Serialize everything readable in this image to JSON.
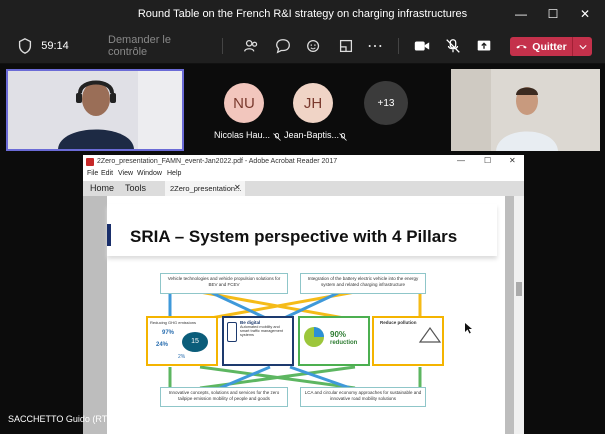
{
  "window": {
    "title": "Round Table on the French R&I strategy on charging infrastructures"
  },
  "toolbar": {
    "timer": "59:14",
    "request_control": "Demander le contrôle",
    "leave_label": "Quitter"
  },
  "participants": [
    {
      "initials": "NU",
      "name": "Nicolas Hau...",
      "color": "#f2c6bd"
    },
    {
      "initials": "JH",
      "name": "Jean-Baptis...",
      "color": "#f0d4c6"
    }
  ],
  "more_count": "+13",
  "acrobat": {
    "title": "2Zero_presentation_FAMN_event-Jan2022.pdf - Adobe Acrobat Reader 2017",
    "menu": [
      "File",
      "Edit",
      "View",
      "Window",
      "Help"
    ],
    "tabs": [
      "Home",
      "Tools",
      "2Zero_presentation..."
    ]
  },
  "slide": {
    "title": "SRIA – System perspective with 4 Pillars",
    "top_left": "Vehicle technologies and vehicle propulsion solutions for BEV and FCEV",
    "top_right": "Integration of the battery electric vehicle into the energy system and related charging infrastructure",
    "pillar1_text": "Reducing GHG emissions",
    "pillar1_values": [
      "97%",
      "24%",
      "15",
      "2%"
    ],
    "pillar2_title": "Be digital",
    "pillar2_text": "Automated mobility and smart traffic management systems",
    "pillar3_value": "90%",
    "pillar3_label": "reduction",
    "pillar4_title": "Reduce pollution",
    "bottom_left": "Innovative concepts, solutions and services for the zero tailpipe emission mobility of people and goods",
    "bottom_right": "LCA and circular economy approaches for sustainable and innovative road mobility solutions"
  },
  "speaker_caption": "SACCHETTO Guido (RTD)"
}
